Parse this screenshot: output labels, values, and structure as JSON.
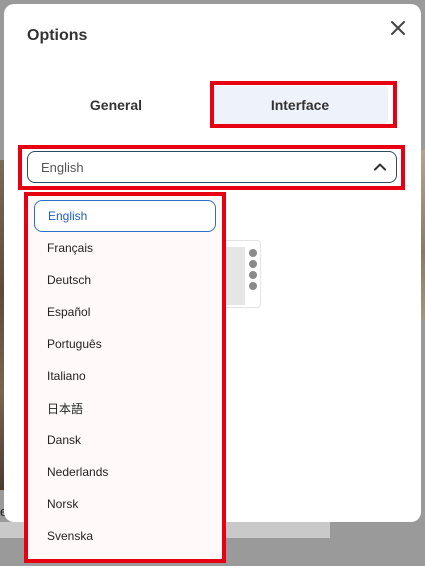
{
  "modal": {
    "title": "Options",
    "close_icon": "close-icon"
  },
  "tabs": [
    {
      "label": "General",
      "active": false
    },
    {
      "label": "Interface",
      "active": true
    }
  ],
  "language_select": {
    "value": "English",
    "expanded": true,
    "chevron_icon": "chevron-up-icon"
  },
  "language_options": [
    {
      "label": "English",
      "selected": true
    },
    {
      "label": "Français",
      "selected": false
    },
    {
      "label": "Deutsch",
      "selected": false
    },
    {
      "label": "Español",
      "selected": false
    },
    {
      "label": "Português",
      "selected": false
    },
    {
      "label": "Italiano",
      "selected": false
    },
    {
      "label": "日本語",
      "selected": false
    },
    {
      "label": "Dansk",
      "selected": false
    },
    {
      "label": "Nederlands",
      "selected": false
    },
    {
      "label": "Norsk",
      "selected": false
    },
    {
      "label": "Svenska",
      "selected": false
    }
  ],
  "background": {
    "partial_text": "e"
  },
  "colors": {
    "highlight": "#e60012",
    "selected_border": "#2a6fc9",
    "active_tab_bg": "#eef2fb"
  }
}
